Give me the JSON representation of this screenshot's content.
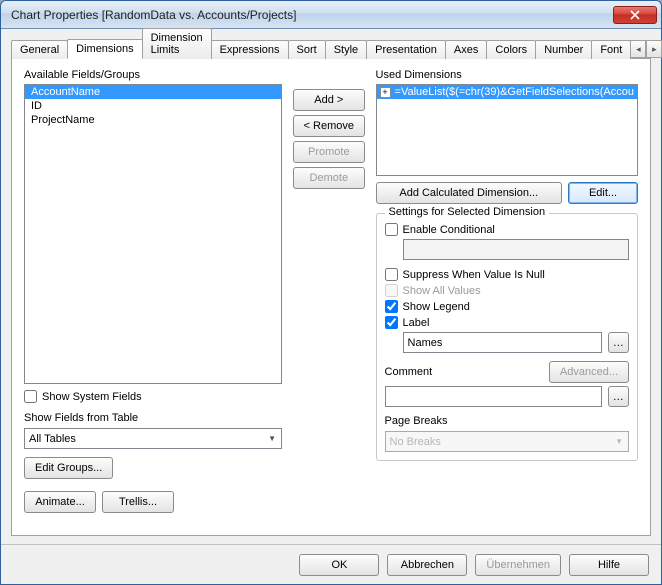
{
  "window": {
    "title": "Chart Properties [RandomData vs. Accounts/Projects]"
  },
  "tabs": {
    "items": [
      "General",
      "Dimensions",
      "Dimension Limits",
      "Expressions",
      "Sort",
      "Style",
      "Presentation",
      "Axes",
      "Colors",
      "Number",
      "Font"
    ],
    "active_index": 1
  },
  "left": {
    "available_label": "Available Fields/Groups",
    "fields": [
      "AccountName",
      "ID",
      "ProjectName"
    ],
    "selected_index": 0,
    "show_system_fields_label": "Show System Fields",
    "show_system_fields_checked": false,
    "show_fields_from_table_label": "Show Fields from Table",
    "tables_value": "All Tables",
    "edit_groups_label": "Edit Groups...",
    "animate_label": "Animate...",
    "trellis_label": "Trellis..."
  },
  "mid": {
    "add_label": "Add >",
    "remove_label": "< Remove",
    "promote_label": "Promote",
    "demote_label": "Demote"
  },
  "right": {
    "used_label": "Used Dimensions",
    "used_item": "=ValueList($(=chr(39)&GetFieldSelections(Accou",
    "add_calc_label": "Add Calculated Dimension...",
    "edit_label": "Edit...",
    "settings_title": "Settings for Selected Dimension",
    "enable_conditional_label": "Enable Conditional",
    "enable_conditional_checked": false,
    "conditional_value": "",
    "suppress_null_label": "Suppress When Value Is Null",
    "suppress_null_checked": false,
    "show_all_values_label": "Show All Values",
    "show_all_values_checked": false,
    "show_legend_label": "Show Legend",
    "show_legend_checked": true,
    "label_label": "Label",
    "label_checked": true,
    "label_value": "Names",
    "comment_label": "Comment",
    "comment_value": "",
    "advanced_label": "Advanced...",
    "page_breaks_label": "Page Breaks",
    "page_breaks_value": "No Breaks"
  },
  "footer": {
    "ok": "OK",
    "cancel": "Abbrechen",
    "apply": "Übernehmen",
    "help": "Hilfe"
  }
}
